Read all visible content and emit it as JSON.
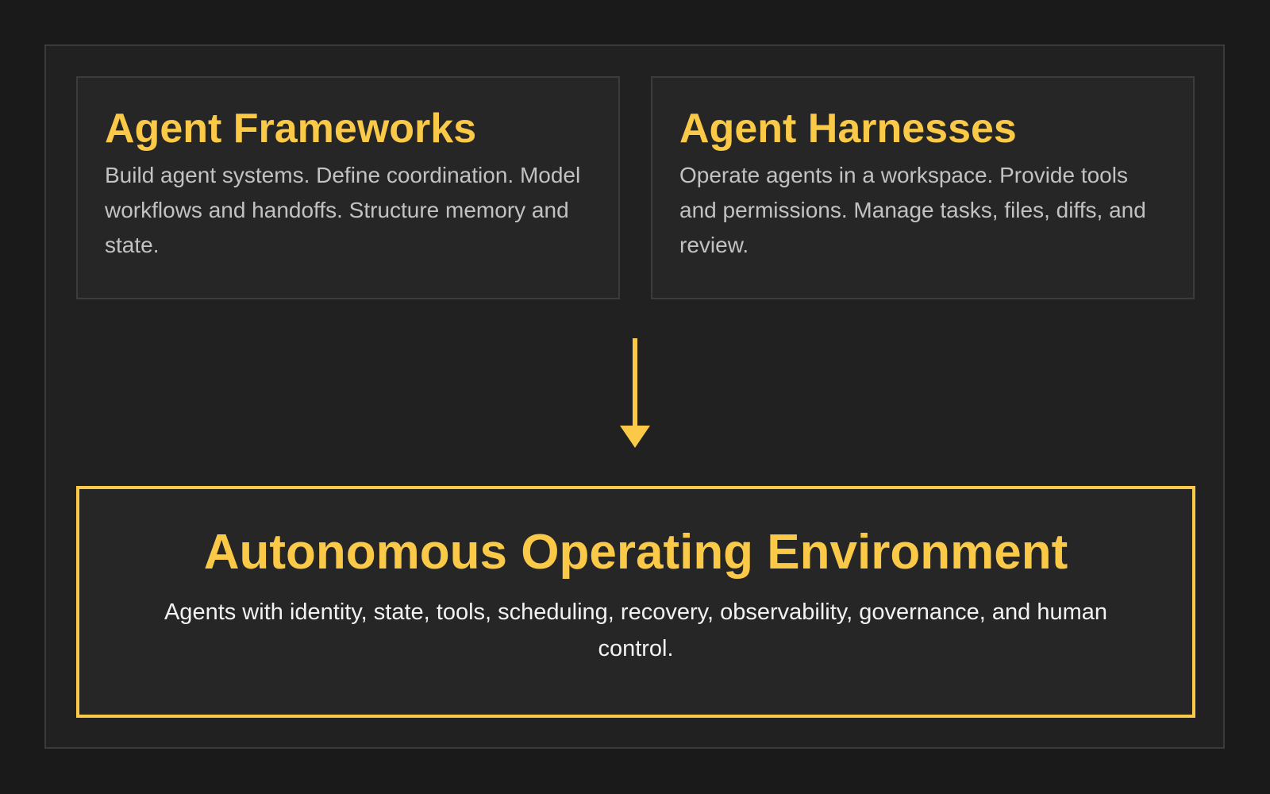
{
  "colors": {
    "background": "#1a1a1a",
    "panel": "#212121",
    "card": "#262626",
    "border": "#3c3c3c",
    "accent": "#f9c947",
    "body_text": "#c2c2c2",
    "env_text": "#f2f2f2"
  },
  "frameworks": {
    "title": "Agent Frameworks",
    "description": "Build agent systems. Define coordination. Model workflows and handoffs. Structure memory and state."
  },
  "harnesses": {
    "title": "Agent Harnesses",
    "description": "Operate agents in a workspace. Provide tools and permissions. Manage tasks, files, diffs, and review."
  },
  "arrow": {
    "icon": "arrow-down-icon"
  },
  "environment": {
    "title": "Autonomous Operating Environment",
    "description": "Agents with identity, state, tools, scheduling, recovery, observability, governance, and human control."
  }
}
